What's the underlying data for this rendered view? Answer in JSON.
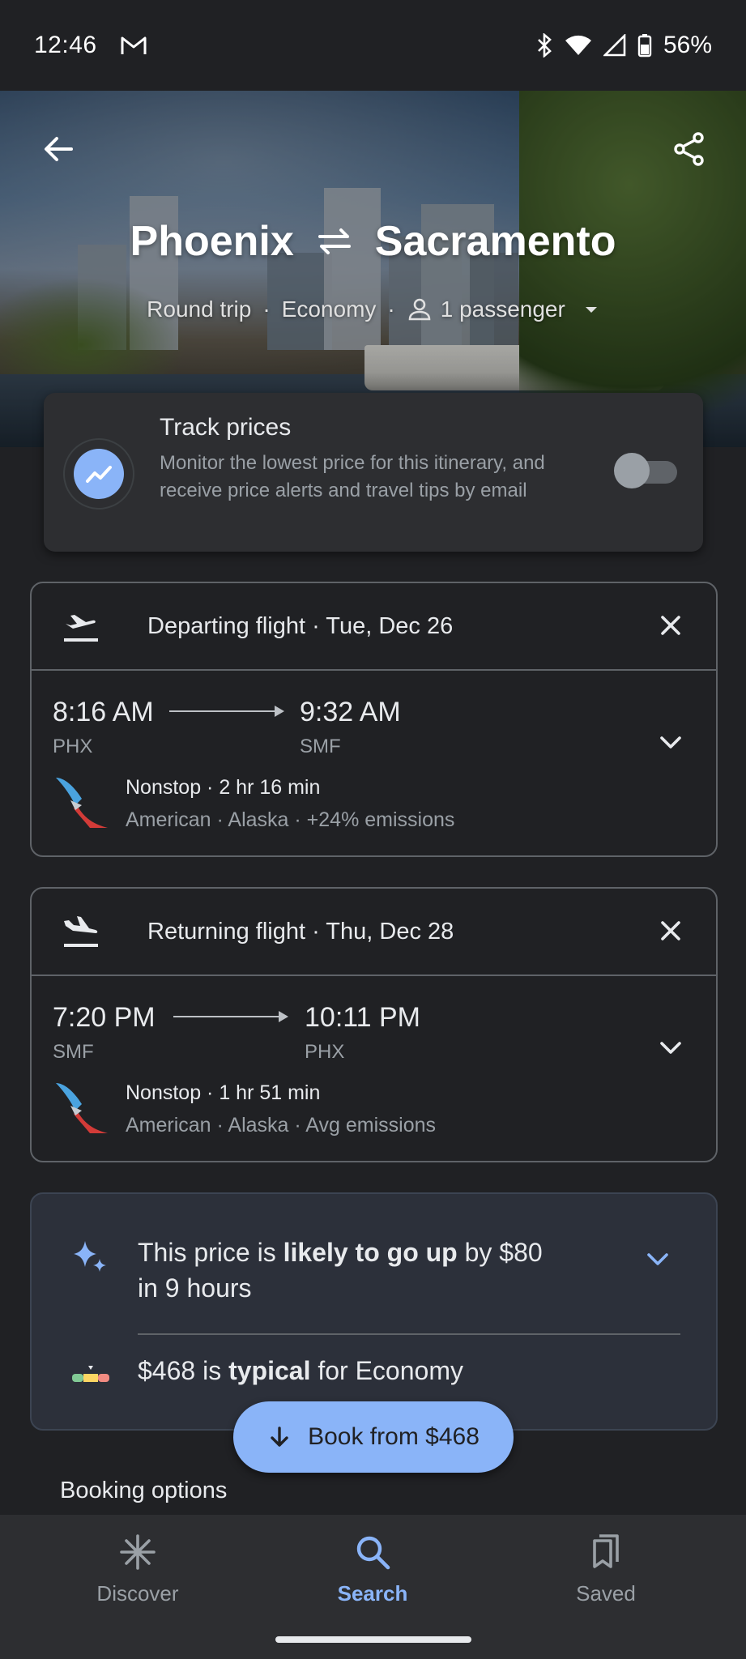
{
  "status_bar": {
    "time": "12:46",
    "battery": "56%"
  },
  "header": {
    "origin": "Phoenix",
    "destination": "Sacramento",
    "trip_type": "Round trip",
    "cabin": "Economy",
    "passengers": "1 passenger"
  },
  "track_prices": {
    "title": "Track prices",
    "description": "Monitor the lowest price for this itinerary, and receive price alerts and travel tips by email",
    "enabled": false
  },
  "departing": {
    "title": "Departing flight · Tue, Dec 26",
    "depart_time": "8:16 AM",
    "arrive_time": "9:32 AM",
    "from_code": "PHX",
    "to_code": "SMF",
    "stops": "Nonstop · 2 hr 16 min",
    "carriers": "American · Alaska · +24% emissions"
  },
  "returning": {
    "title": "Returning flight · Thu, Dec 28",
    "depart_time": "7:20 PM",
    "arrive_time": "10:11 PM",
    "from_code": "SMF",
    "to_code": "PHX",
    "stops": "Nonstop · 1 hr 51 min",
    "carriers": "American · Alaska · Avg emissions"
  },
  "insight": {
    "prefix": "This price is ",
    "bold": "likely to go up",
    "middle": " by $80",
    "line2": "in 9 hours",
    "typical_price": "$468 is ",
    "typical_bold": "typical",
    "typical_suffix": " for Economy"
  },
  "book_button": "Book from $468",
  "booking_options_label": "Booking options",
  "bottom_nav": {
    "discover": "Discover",
    "search": "Search",
    "saved": "Saved",
    "active": "search"
  },
  "colors": {
    "accent": "#8ab4f8",
    "background": "#202124",
    "card": "#2d2e31"
  }
}
